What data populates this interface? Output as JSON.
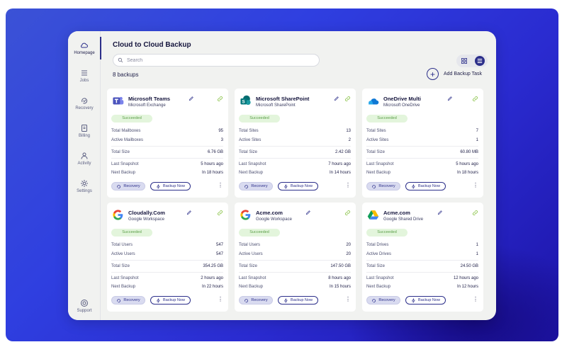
{
  "title": "Cloud to Cloud Backup",
  "search": {
    "placeholder": "Search"
  },
  "backup_count": "8 backups",
  "add_task_label": "Add Backup Task",
  "sidebar": {
    "items": [
      {
        "label": "Homepage",
        "icon": "cloud-icon"
      },
      {
        "label": "Jobs",
        "icon": "jobs-icon"
      },
      {
        "label": "Recovery",
        "icon": "recovery-icon"
      },
      {
        "label": "Billing",
        "icon": "billing-icon"
      },
      {
        "label": "Activity",
        "icon": "activity-icon"
      },
      {
        "label": "Settings",
        "icon": "gear-icon"
      }
    ],
    "support": {
      "label": "Support",
      "icon": "support-icon"
    }
  },
  "card_labels": {
    "recovery": "Recovery",
    "backup_now": "Backup Now"
  },
  "cards": [
    {
      "name": "Microsoft Teams",
      "service": "Microsoft Exchange",
      "status": "Succeeded",
      "logo": "teams-logo",
      "stats": [
        [
          "Total Mailboxes",
          "95"
        ],
        [
          "Active Mailboxes",
          "3"
        ]
      ],
      "size_label": "Total Size",
      "size": "6.76 GB",
      "last_label": "Last Snapshot",
      "last": "5 hours ago",
      "next_label": "Next Backup",
      "next": "In 18 hours"
    },
    {
      "name": "Microsoft SharePoint",
      "service": "Microsoft SharePoint",
      "status": "Succeeded",
      "logo": "sharepoint-logo",
      "stats": [
        [
          "Total Sites",
          "13"
        ],
        [
          "Active Sites",
          "2"
        ]
      ],
      "size_label": "Total Size",
      "size": "2.42 GB",
      "last_label": "Last Snapshot",
      "last": "7 hours ago",
      "next_label": "Next Backup",
      "next": "In 14 hours"
    },
    {
      "name": "OneDrive Multi",
      "service": "Microsoft OneDrive",
      "status": "Succeeded",
      "logo": "onedrive-logo",
      "stats": [
        [
          "Total Sites",
          "7"
        ],
        [
          "Active Sites",
          "1"
        ]
      ],
      "size_label": "Total Size",
      "size": "60.80 MB",
      "last_label": "Last Snapshot",
      "last": "5 hours ago",
      "next_label": "Next Backup",
      "next": "In 18 hours"
    },
    {
      "name": "Cloudally.Com",
      "service": "Google Workspace",
      "status": "Succeeded",
      "logo": "google-logo",
      "stats": [
        [
          "Total Users",
          "547"
        ],
        [
          "Active Users",
          "547"
        ]
      ],
      "size_label": "Total Size",
      "size": "354.25 GB",
      "last_label": "Last Snapshot",
      "last": "2 hours ago",
      "next_label": "Next Backup",
      "next": "In 22 hours"
    },
    {
      "name": "Acme.com",
      "service": "Google Workspace",
      "status": "Succeeded",
      "logo": "google-logo",
      "stats": [
        [
          "Total Users",
          "20"
        ],
        [
          "Active Users",
          "20"
        ]
      ],
      "size_label": "Total Size",
      "size": "147.50 GB",
      "last_label": "Last Snapshot",
      "last": "8 hours ago",
      "next_label": "Next Backup",
      "next": "In 15 hours"
    },
    {
      "name": "Acme.com",
      "service": "Google Shared Drive",
      "status": "Succeeded",
      "logo": "google-drive-logo",
      "stats": [
        [
          "Total Drives",
          "1"
        ],
        [
          "Active Drives",
          "1"
        ]
      ],
      "size_label": "Total Size",
      "size": "24.50 GB",
      "last_label": "Last Snapshot",
      "last": "12 hours ago",
      "next_label": "Next Backup",
      "next": "In 12 hours"
    }
  ],
  "colors": {
    "accent": "#2c2f8a",
    "success_bg": "#e3f5dc",
    "success_text": "#5a9e47",
    "background": "#3443d8"
  }
}
